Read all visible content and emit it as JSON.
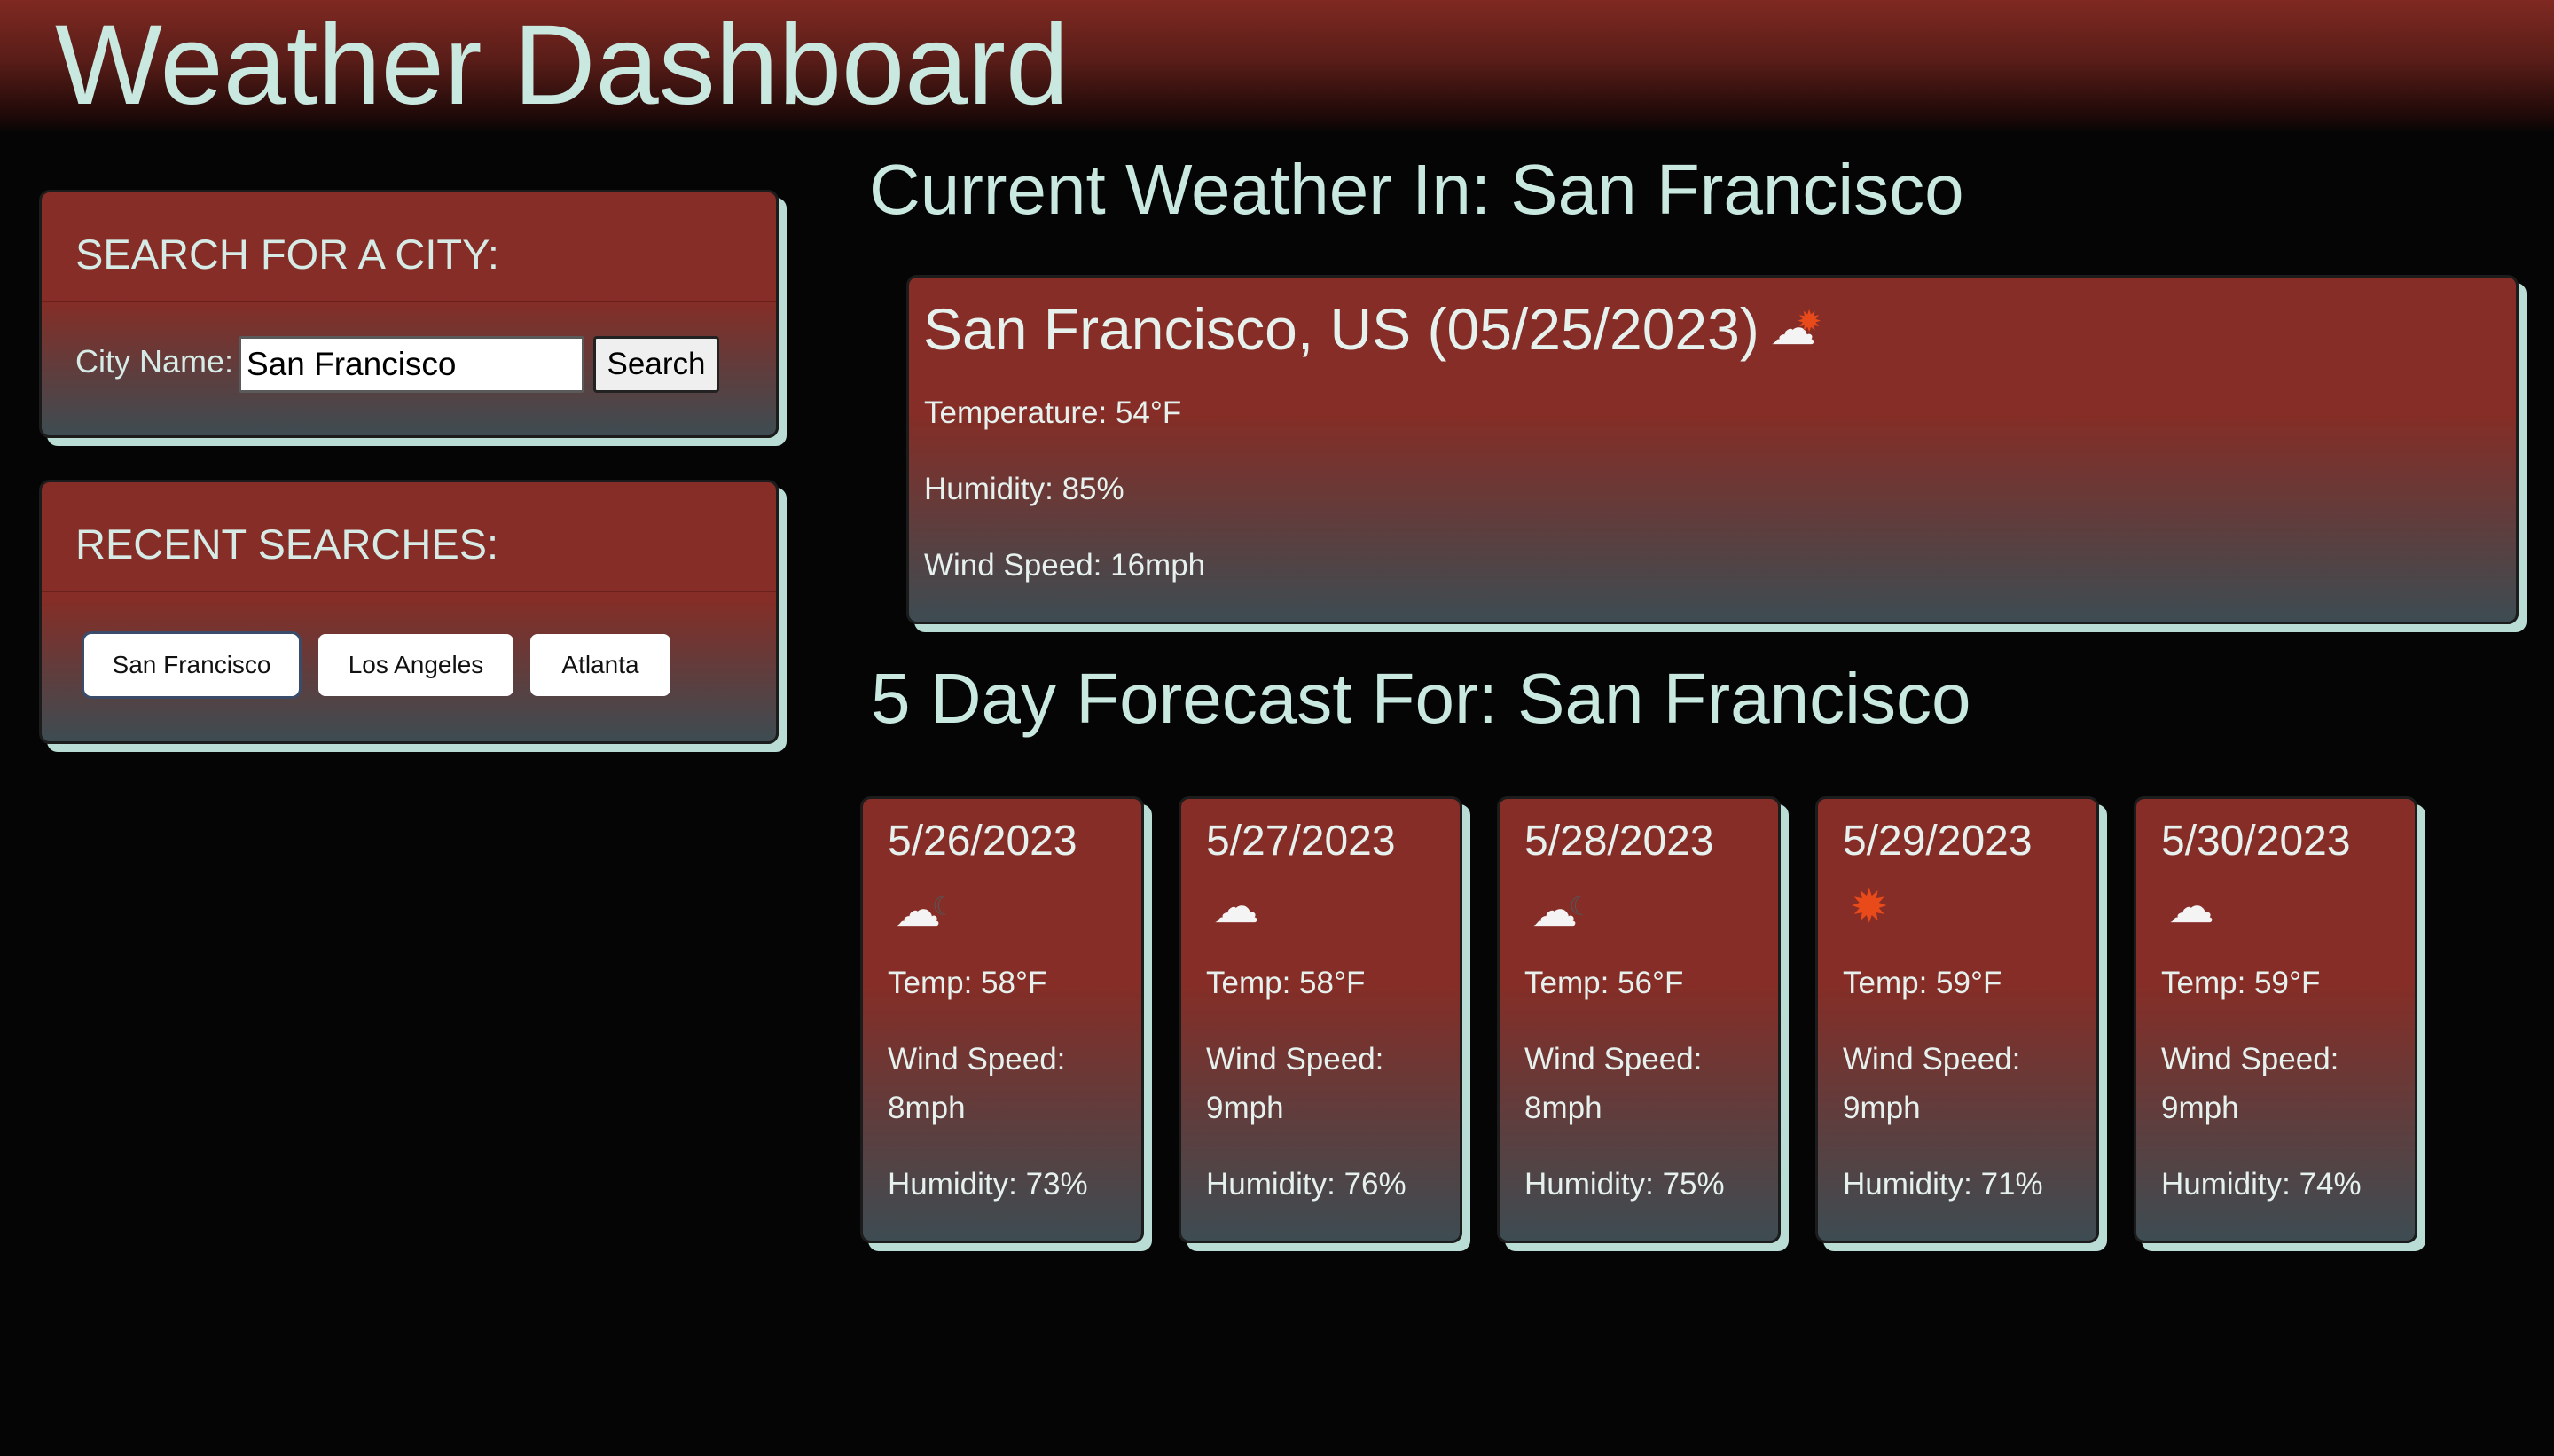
{
  "app": {
    "title": "Weather Dashboard"
  },
  "search": {
    "title": "SEARCH FOR A CITY:",
    "label": "City Name:",
    "value": "San Francisco",
    "button": "Search"
  },
  "recent": {
    "title": "RECENT SEARCHES:",
    "items": [
      "San Francisco",
      "Los Angeles",
      "Atlanta"
    ]
  },
  "current": {
    "section_title": "Current Weather In: San Francisco",
    "heading": "San Francisco, US (05/25/2023)",
    "icon": "partly-cloudy-sun-icon",
    "temperature": "Temperature: 54°F",
    "humidity": "Humidity: 85%",
    "wind": "Wind Speed: 16mph"
  },
  "forecast": {
    "section_title": "5 Day Forecast For: San Francisco",
    "days": [
      {
        "date": "5/26/2023",
        "icon": "cloud-moon-icon",
        "glyph": "☁",
        "temp": "Temp: 58°F",
        "wind": "Wind Speed: 8mph",
        "humidity": "Humidity: 73%"
      },
      {
        "date": "5/27/2023",
        "icon": "cloud-icon",
        "glyph": "☁",
        "temp": "Temp: 58°F",
        "wind": "Wind Speed: 9mph",
        "humidity": "Humidity: 76%"
      },
      {
        "date": "5/28/2023",
        "icon": "cloud-moon-icon",
        "glyph": "☁",
        "temp": "Temp: 56°F",
        "wind": "Wind Speed: 8mph",
        "humidity": "Humidity: 75%"
      },
      {
        "date": "5/29/2023",
        "icon": "sun-icon",
        "glyph": "✹",
        "temp": "Temp: 59°F",
        "wind": "Wind Speed: 9mph",
        "humidity": "Humidity: 71%"
      },
      {
        "date": "5/30/2023",
        "icon": "cloud-icon",
        "glyph": "☁",
        "temp": "Temp: 59°F",
        "wind": "Wind Speed: 9mph",
        "humidity": "Humidity: 74%"
      }
    ]
  },
  "colors": {
    "header_red": "#7f2922",
    "card_red": "#852d26",
    "card_bottom": "#3d4c52",
    "text_mint": "#c9e9e0",
    "shadow_mint": "#b9ddd5",
    "background": "#050505"
  }
}
